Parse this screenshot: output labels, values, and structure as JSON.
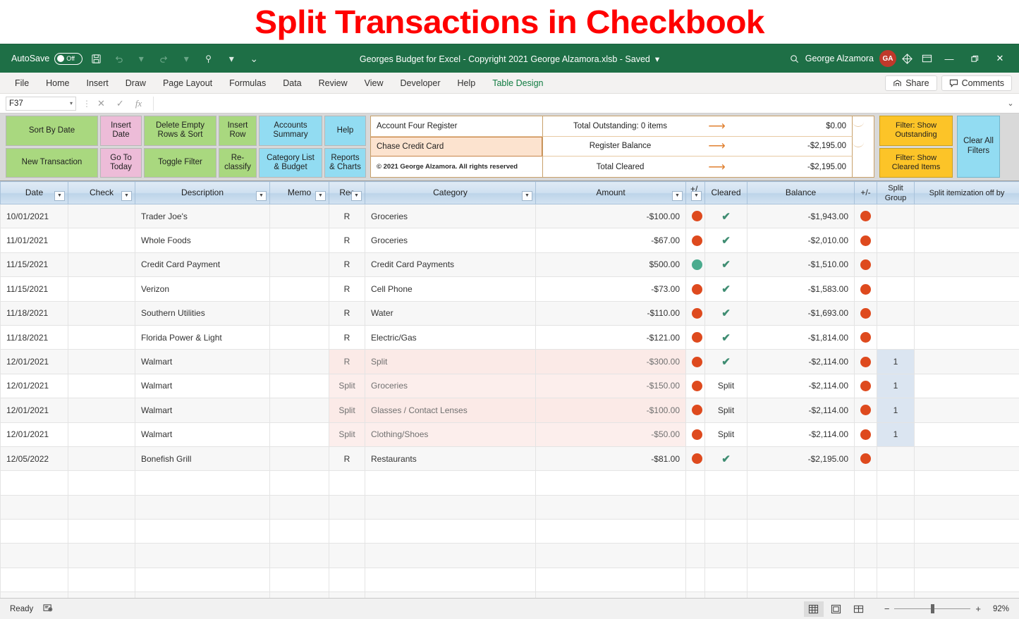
{
  "banner": {
    "title": "Split Transactions in Checkbook"
  },
  "titlebar": {
    "autosave_label": "AutoSave",
    "autosave_state": "Off",
    "document_title": "Georges Budget for Excel - Copyright 2021 George Alzamora.xlsb  -  Saved",
    "user_name": "George Alzamora",
    "avatar_initials": "GA",
    "icons": [
      "save-icon",
      "undo-icon",
      "redo-icon",
      "touch-mode-icon",
      "customize-quick-access-icon"
    ],
    "search_icon": "search-icon",
    "diamond_icon": "diamond-icon",
    "ribbon_display_icon": "ribbon-display-options-icon",
    "minimize": "—",
    "restore": "❐",
    "close": "✕"
  },
  "ribbon": {
    "tabs": [
      "File",
      "Home",
      "Insert",
      "Draw",
      "Page Layout",
      "Formulas",
      "Data",
      "Review",
      "View",
      "Developer",
      "Help",
      "Table Design"
    ],
    "active_tab": "Table Design",
    "share_label": "Share",
    "comments_label": "Comments"
  },
  "formula_bar": {
    "name_box": "F37",
    "cancel_icon": "✕",
    "enter_icon": "✓",
    "function_icon": "fx",
    "formula_value": "",
    "expand_icon": "⌄"
  },
  "panel": {
    "buttons": [
      {
        "label": "Sort By Date",
        "color": "g"
      },
      {
        "label": "Insert\nDate",
        "color": "p"
      },
      {
        "label": "Delete Empty\nRows & Sort",
        "color": "g"
      },
      {
        "label": "Insert\nRow",
        "color": "g"
      },
      {
        "label": "Accounts\nSummary",
        "color": "b"
      },
      {
        "label": "Help",
        "color": "b"
      },
      {
        "label": "New Transaction",
        "color": "g"
      },
      {
        "label": "Go To\nToday",
        "color": "p"
      },
      {
        "label": "Toggle Filter",
        "color": "g"
      },
      {
        "label": "Re-\nclassify",
        "color": "g"
      },
      {
        "label": "Category List\n& Budget",
        "color": "b"
      },
      {
        "label": "Reports\n& Charts",
        "color": "b"
      }
    ],
    "register": {
      "account_title": "Account Four Register",
      "account_name": "Chase Credit Card",
      "copyright": "© 2021 George Alzamora. All rights reserved",
      "rows": [
        {
          "label": "Total Outstanding: 0 items",
          "amount": "$0.00",
          "dot": "tan"
        },
        {
          "label": "Register Balance",
          "amount": "-$2,195.00",
          "dot": "red"
        },
        {
          "label": "Total Cleared",
          "amount": "-$2,195.00",
          "dot": "red"
        }
      ]
    },
    "filters": {
      "show_outstanding": "Filter: Show\nOutstanding",
      "show_cleared": "Filter: Show\nCleared Items",
      "clear_all": "Clear All\nFilters"
    }
  },
  "table": {
    "headers": [
      {
        "label": "Date",
        "filter": true
      },
      {
        "label": "Check",
        "filter": true
      },
      {
        "label": "Description",
        "filter": true
      },
      {
        "label": "Memo",
        "filter": true
      },
      {
        "label": "Rec",
        "filter": true
      },
      {
        "label": "Category",
        "filter": true
      },
      {
        "label": "Amount",
        "filter": true
      },
      {
        "label": "+/",
        "filter": true
      },
      {
        "label": "Cleared",
        "filter": false
      },
      {
        "label": "Balance",
        "filter": false
      },
      {
        "label": "+/-",
        "filter": false
      },
      {
        "label": "Split\nGroup",
        "filter": false
      },
      {
        "label": "Split itemization off by",
        "filter": false
      }
    ],
    "rows": [
      {
        "date": "10/01/2021",
        "check": "",
        "description": "Trader Joe's",
        "memo": "",
        "rec": "R",
        "category": "Groceries",
        "amount": "-$100.00",
        "amount_dot": "red",
        "cleared": "check",
        "balance": "-$1,943.00",
        "balance_dot": "red",
        "split_group": "",
        "split_off": "",
        "band": true,
        "highlight": false
      },
      {
        "date": "11/01/2021",
        "check": "",
        "description": "Whole Foods",
        "memo": "",
        "rec": "R",
        "category": "Groceries",
        "amount": "-$67.00",
        "amount_dot": "red",
        "cleared": "check",
        "balance": "-$2,010.00",
        "balance_dot": "red",
        "split_group": "",
        "split_off": "",
        "band": false,
        "highlight": false
      },
      {
        "date": "11/15/2021",
        "check": "",
        "description": "Credit Card Payment",
        "memo": "",
        "rec": "R",
        "category": "Credit Card Payments",
        "amount": "$500.00",
        "amount_dot": "green",
        "cleared": "check",
        "balance": "-$1,510.00",
        "balance_dot": "red",
        "split_group": "",
        "split_off": "",
        "band": true,
        "highlight": false
      },
      {
        "date": "11/15/2021",
        "check": "",
        "description": "Verizon",
        "memo": "",
        "rec": "R",
        "category": "Cell Phone",
        "amount": "-$73.00",
        "amount_dot": "red",
        "cleared": "check",
        "balance": "-$1,583.00",
        "balance_dot": "red",
        "split_group": "",
        "split_off": "",
        "band": false,
        "highlight": false
      },
      {
        "date": "11/18/2021",
        "check": "",
        "description": "Southern Utilities",
        "memo": "",
        "rec": "R",
        "category": "Water",
        "amount": "-$110.00",
        "amount_dot": "red",
        "cleared": "check",
        "balance": "-$1,693.00",
        "balance_dot": "red",
        "split_group": "",
        "split_off": "",
        "band": true,
        "highlight": false
      },
      {
        "date": "11/18/2021",
        "check": "",
        "description": "Florida Power & Light",
        "memo": "",
        "rec": "R",
        "category": "Electric/Gas",
        "amount": "-$121.00",
        "amount_dot": "red",
        "cleared": "check",
        "balance": "-$1,814.00",
        "balance_dot": "red",
        "split_group": "",
        "split_off": "",
        "band": false,
        "highlight": false
      },
      {
        "date": "12/01/2021",
        "check": "",
        "description": "Walmart",
        "memo": "",
        "rec": "R",
        "category": "Split",
        "amount": "-$300.00",
        "amount_dot": "red",
        "cleared": "check",
        "balance": "-$2,114.00",
        "balance_dot": "red",
        "split_group": "1",
        "split_off": "",
        "band": true,
        "highlight": true
      },
      {
        "date": "12/01/2021",
        "check": "",
        "description": "Walmart",
        "memo": "",
        "rec": "Split",
        "category": "Groceries",
        "amount": "-$150.00",
        "amount_dot": "red",
        "cleared": "Split",
        "balance": "-$2,114.00",
        "balance_dot": "red",
        "split_group": "1",
        "split_off": "",
        "band": false,
        "highlight": true
      },
      {
        "date": "12/01/2021",
        "check": "",
        "description": "Walmart",
        "memo": "",
        "rec": "Split",
        "category": "Glasses / Contact Lenses",
        "amount": "-$100.00",
        "amount_dot": "red",
        "cleared": "Split",
        "balance": "-$2,114.00",
        "balance_dot": "red",
        "split_group": "1",
        "split_off": "",
        "band": true,
        "highlight": true
      },
      {
        "date": "12/01/2021",
        "check": "",
        "description": "Walmart",
        "memo": "",
        "rec": "Split",
        "category": "Clothing/Shoes",
        "amount": "-$50.00",
        "amount_dot": "red",
        "cleared": "Split",
        "balance": "-$2,114.00",
        "balance_dot": "red",
        "split_group": "1",
        "split_off": "",
        "band": false,
        "highlight": true
      },
      {
        "date": "12/05/2022",
        "check": "",
        "description": "Bonefish Grill",
        "memo": "",
        "rec": "R",
        "category": "Restaurants",
        "amount": "-$81.00",
        "amount_dot": "red",
        "cleared": "check",
        "balance": "-$2,195.00",
        "balance_dot": "red",
        "split_group": "",
        "split_off": "",
        "band": true,
        "highlight": false
      }
    ],
    "empty_row_count": 6
  },
  "annotation": {
    "shape": "curved-arrow-and-bracket",
    "color": "#cc2027",
    "fill": "#f6c7c7"
  },
  "statusbar": {
    "status": "Ready",
    "macro_icon": "record-macro-icon",
    "views": [
      "normal-view-icon",
      "page-layout-view-icon",
      "page-break-preview-icon"
    ],
    "active_view": "normal-view-icon",
    "zoom_out": "−",
    "zoom_in": "+",
    "zoom_level": "92%"
  },
  "colors": {
    "excel_green": "#1e6f46",
    "accent_red": "#ff0000",
    "annotation_red": "#cc2027",
    "split_highlight": "#fceeec",
    "split_group_fill": "#dbe5f1",
    "yellow_btn": "#fcc428",
    "green_btn": "#a9d87f",
    "pink_btn": "#edbcd8",
    "blue_btn": "#92dcf2"
  }
}
